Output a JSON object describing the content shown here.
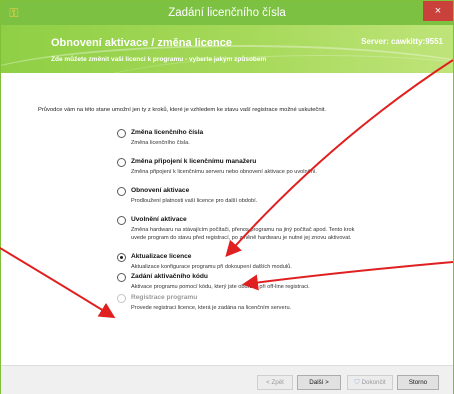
{
  "window": {
    "title": "Zadání licenčního čísla",
    "close_glyph": "×",
    "app_icon": "key-icon"
  },
  "banner": {
    "title": "Obnovení aktivace / změna licence",
    "subtitle": "Zde můžete změnit vaši licenci k programu - vyberte jakým způsobem",
    "server": "Server: cawkitty:9551"
  },
  "intro": "Průvodce vám na této stane umožní jen ty z kroků, které je vzhledem ke stavu vaší registrace možné uskutečnit.",
  "options": [
    {
      "label": "Změna licenčního čísla",
      "desc": [
        "Změna licenčního čísla."
      ],
      "selected": false,
      "disabled": false
    },
    {
      "label": "Změna připojení k licenčnímu manažeru",
      "desc": [
        "Změna připojení k licenčnímu serveru nebo obnovení aktivace po uvolnění."
      ],
      "selected": false,
      "disabled": false
    },
    {
      "label": "Obnovení aktivace",
      "desc": [
        "Prodloužení platnosti vaší licence pro další období."
      ],
      "selected": false,
      "disabled": false
    },
    {
      "label": "Uvolnění aktivace",
      "desc": [
        "Změna hardwaru na stávajícím počítači, přenos programu na jiný počítač apod. Tento krok",
        "uvede program do stavu před registrací, po změně hardwaru je nutné jej znovu aktivovat."
      ],
      "selected": false,
      "disabled": false
    },
    {
      "label": "Aktualizace licence",
      "desc": [
        "Aktualizace konfigurace programu při dokoupení dalších modulů."
      ],
      "selected": true,
      "disabled": false
    },
    {
      "label": "Zadání aktivačního kódu",
      "desc": [
        "Aktivace programu pomocí kódu, který jste obdrželi při off-line registraci."
      ],
      "selected": false,
      "disabled": false
    },
    {
      "label": "Registrace programu",
      "desc": [
        "Provede registraci licence, která je zadána na licenčním serveru."
      ],
      "selected": false,
      "disabled": true
    }
  ],
  "footer": {
    "back": "< Zpět",
    "next": "Další >",
    "finish": "Dokončit",
    "cancel": "Storno",
    "shield_icon": "uac-shield-icon"
  },
  "colors": {
    "titlebar": "#7cc142",
    "close": "#c9413a",
    "arrow": "#e02020"
  }
}
